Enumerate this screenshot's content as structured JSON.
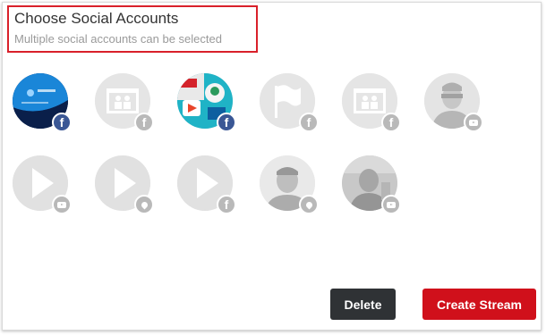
{
  "dialog": {
    "title": "Choose Social Accounts",
    "subtitle": "Multiple social accounts can be selected"
  },
  "accounts": [
    {
      "icon": "facebook-page-blue-avatar",
      "network": "facebook",
      "state": "enabled"
    },
    {
      "icon": "facebook-page-placeholder-icon",
      "network": "facebook",
      "state": "disabled"
    },
    {
      "icon": "youtube-channel-teal-avatar",
      "network": "facebook",
      "state": "enabled"
    },
    {
      "icon": "flag-placeholder-icon",
      "network": "facebook",
      "state": "disabled"
    },
    {
      "icon": "facebook-page-placeholder-icon",
      "network": "facebook",
      "state": "disabled"
    },
    {
      "icon": "person-photo-avatar",
      "network": "youtube",
      "state": "disabled"
    },
    {
      "icon": "play-placeholder-icon",
      "network": "youtube",
      "state": "disabled"
    },
    {
      "icon": "play-placeholder-icon",
      "network": "location",
      "state": "disabled"
    },
    {
      "icon": "play-placeholder-icon",
      "network": "facebook",
      "state": "disabled"
    },
    {
      "icon": "person-photo-avatar",
      "network": "location",
      "state": "disabled"
    },
    {
      "icon": "person-photo-avatar",
      "network": "youtube",
      "state": "disabled"
    }
  ],
  "buttons": {
    "delete_label": "Delete",
    "create_label": "Create Stream"
  },
  "colors": {
    "highlight": "#d9202a",
    "facebook": "#3a5795",
    "delete_button": "#2f3235",
    "create_button": "#d0101b"
  }
}
